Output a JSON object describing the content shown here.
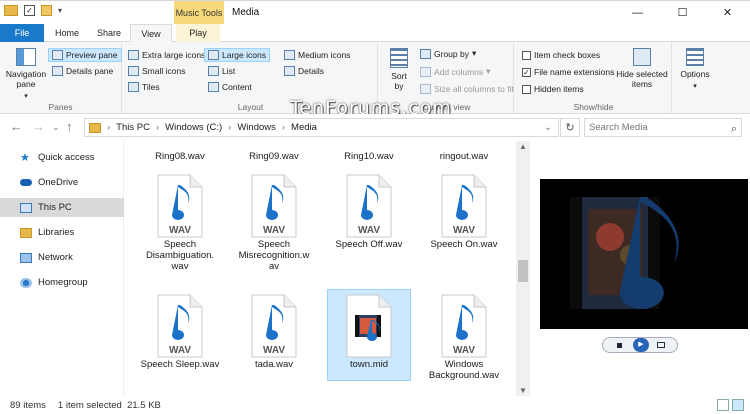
{
  "window": {
    "title": "Media",
    "context_tab": "Music Tools",
    "controls": {
      "minimize": "—",
      "maximize": "☐",
      "close": "✕"
    }
  },
  "tabs": {
    "file": "File",
    "home": "Home",
    "share": "Share",
    "view": "View",
    "play": "Play"
  },
  "ribbon": {
    "panes": {
      "navigation_pane": "Navigation pane",
      "preview_pane": "Preview pane",
      "details_pane": "Details pane",
      "label": "Panes"
    },
    "layout": {
      "extra_large": "Extra large icons",
      "large": "Large icons",
      "medium": "Medium icons",
      "small": "Small icons",
      "list": "List",
      "details": "Details",
      "tiles": "Tiles",
      "content": "Content",
      "label": "Layout"
    },
    "current_view": {
      "sort_by": "Sort by",
      "group_by": "Group by",
      "add_columns": "Add columns",
      "size_columns": "Size all columns to fit",
      "label": "Current view"
    },
    "show_hide": {
      "item_check_boxes": "Item check boxes",
      "file_name_extensions": "File name extensions",
      "hidden_items": "Hidden items",
      "hide_selected": "Hide selected items",
      "label": "Show/hide"
    },
    "options": "Options"
  },
  "watermark": "TenForums.com",
  "address": {
    "path": [
      "This PC",
      "Windows (C:)",
      "Windows",
      "Media"
    ],
    "search_placeholder": "Search Media"
  },
  "navpane": {
    "items": [
      {
        "label": "Quick access"
      },
      {
        "label": "OneDrive"
      },
      {
        "label": "This PC"
      },
      {
        "label": "Libraries"
      },
      {
        "label": "Network"
      },
      {
        "label": "Homegroup"
      }
    ]
  },
  "files": {
    "row0": [
      "Ring08.wav",
      "Ring09.wav",
      "Ring10.wav",
      "ringout.wav"
    ],
    "row1": [
      {
        "line1": "Speech",
        "line2": "Disambiguation.",
        "line3": "wav"
      },
      {
        "line1": "Speech",
        "line2": "Misrecognition.w",
        "line3": "av"
      },
      {
        "line1": "Speech Off.wav",
        "line2": "",
        "line3": ""
      },
      {
        "line1": "Speech On.wav",
        "line2": "",
        "line3": ""
      }
    ],
    "row2": [
      {
        "line1": "Speech Sleep.wav",
        "line2": ""
      },
      {
        "line1": "tada.wav",
        "line2": ""
      },
      {
        "line1": "town.mid",
        "line2": ""
      },
      {
        "line1": "Windows",
        "line2": "Background.wav"
      }
    ],
    "wav_badge": "WAV"
  },
  "status": {
    "count": "89 items",
    "selection": "1 item selected  21.5 KB"
  },
  "colors": {
    "accent": "#1979ca",
    "context_tab": "#f6d97a",
    "selection": "#cce8ff",
    "note_blue": "#1a73c9"
  }
}
